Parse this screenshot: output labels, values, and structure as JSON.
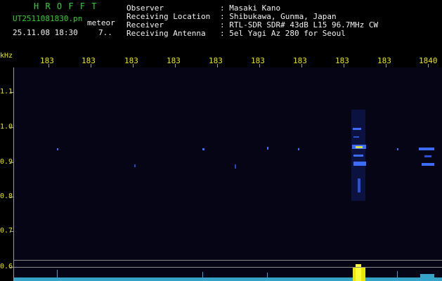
{
  "header": {
    "station": "H R O F F T",
    "filename": "UT2511081830.pn",
    "mode": "meteor",
    "datetime": "25.11.08 18:30",
    "count": "7..",
    "info_labels": [
      "Observer",
      "Receiving Location",
      "Receiver",
      "Receiving Antenna"
    ],
    "info_values": [
      ": Masaki Kano",
      ": Shibukawa, Gunma, Japan",
      ": RTL-SDR SDR# 43dB L15 96.7MHz CW",
      ": 5el Yagi Az 280 for Seoul"
    ]
  },
  "spectrogram": {
    "y_unit": "kHz",
    "x_tick_labels": [
      "183",
      "183",
      "183",
      "183",
      "183",
      "183",
      "183",
      "183",
      "183",
      "1840"
    ],
    "y_tick_labels": [
      "1.1",
      "1.0",
      "0.9",
      "0.8",
      "0.7",
      "0.6"
    ],
    "colors": {
      "background": "#050516",
      "signal": "#3b6bff",
      "signal_bright": "#ffff40",
      "axis_labels": "#e8e800",
      "title": "#2fd12f",
      "info": "#f2f2f2"
    }
  }
}
